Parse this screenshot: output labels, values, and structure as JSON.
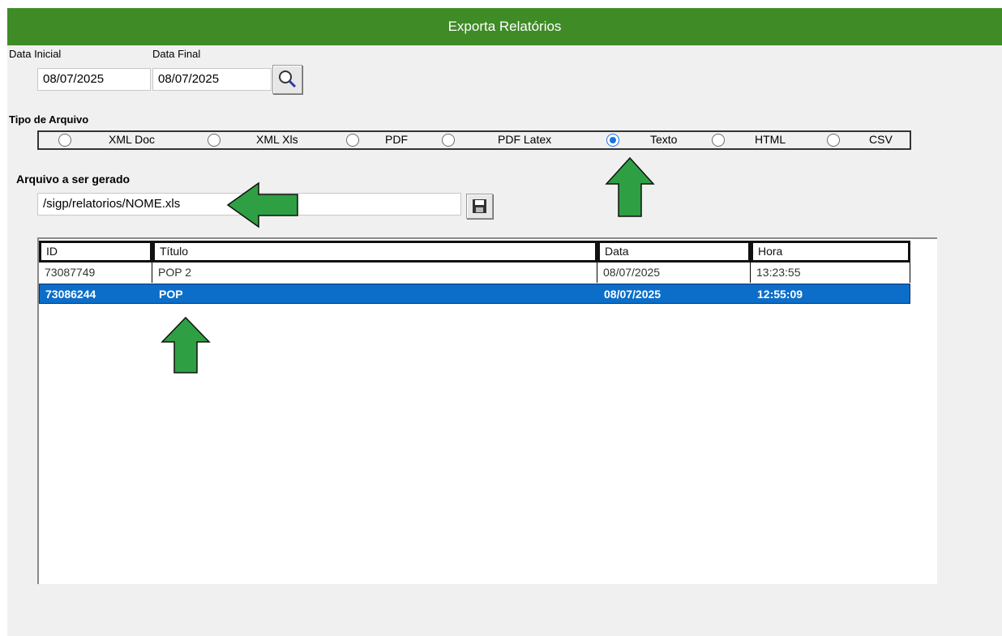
{
  "window": {
    "title": "Exporta Relatórios"
  },
  "dates": {
    "start_label": "Data Inicial",
    "start_value": "08/07/2025",
    "end_label": "Data Final",
    "end_value": "08/07/2025",
    "search_icon": "magnifier-icon"
  },
  "file_type": {
    "label": "Tipo de Arquivo",
    "options": [
      {
        "label": "XML Doc",
        "selected": false
      },
      {
        "label": "XML Xls",
        "selected": false
      },
      {
        "label": "PDF",
        "selected": false
      },
      {
        "label": "PDF Latex",
        "selected": false
      },
      {
        "label": "Texto",
        "selected": true
      },
      {
        "label": "HTML",
        "selected": false
      },
      {
        "label": "CSV",
        "selected": false
      }
    ]
  },
  "output": {
    "label": "Arquivo a ser gerado",
    "path": "/sigp/relatorios/NOME.xls",
    "save_icon": "floppy-disk-icon"
  },
  "table": {
    "columns": [
      "ID",
      "Título",
      "Data",
      "Hora"
    ],
    "rows": [
      {
        "id": "73087749",
        "title": "POP 2",
        "date": "08/07/2025",
        "time": "13:23:55",
        "selected": false
      },
      {
        "id": "73086244",
        "title": "POP",
        "date": "08/07/2025",
        "time": "12:55:09",
        "selected": true
      }
    ]
  },
  "colors": {
    "title_bar": "#3f8b26",
    "selection": "#0c6ec9",
    "annotation_arrow": "#2ea043"
  }
}
